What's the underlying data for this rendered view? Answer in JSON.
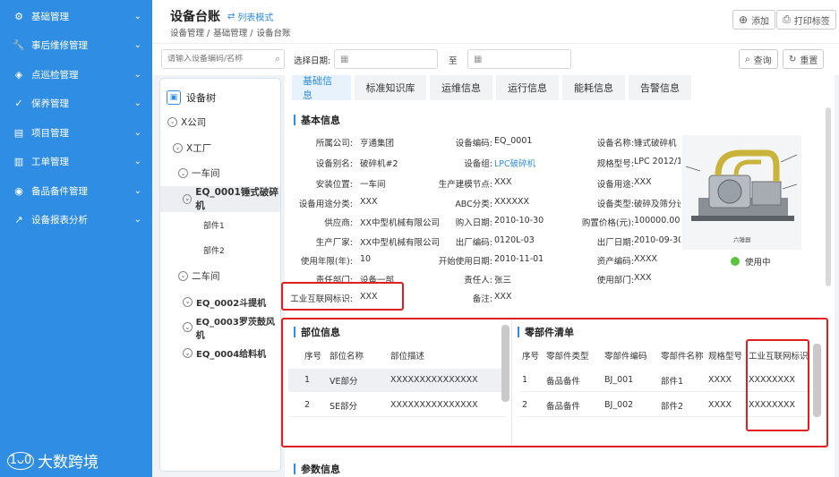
{
  "sidebar": {
    "items": [
      {
        "label": "基础管理",
        "icon": "gear-icon",
        "glyph": "⚙"
      },
      {
        "label": "事后维修管理",
        "icon": "wrench-icon",
        "glyph": "🔧"
      },
      {
        "label": "点巡检管理",
        "icon": "shield-icon",
        "glyph": "◈"
      },
      {
        "label": "保养管理",
        "icon": "check-circle-icon",
        "glyph": "✓"
      },
      {
        "label": "项目管理",
        "icon": "document-icon",
        "glyph": "▤"
      },
      {
        "label": "工单管理",
        "icon": "clipboard-icon",
        "glyph": "▥"
      },
      {
        "label": "备品备件管理",
        "icon": "box-icon",
        "glyph": "◉"
      },
      {
        "label": "设备报表分析",
        "icon": "chart-icon",
        "glyph": "↗"
      }
    ],
    "brand": "大数跨境"
  },
  "header": {
    "title": "设备台账",
    "mode_link": "列表模式",
    "breadcrumb": [
      "设备管理 /",
      "基础管理 /",
      "设备台账"
    ],
    "add_label": "添加",
    "print_label": "打印标签"
  },
  "filter": {
    "search_placeholder": "请输入设备编码/名称",
    "date_label": "选择日期:",
    "to_label": "至",
    "query_label": "查询",
    "reset_label": "重置"
  },
  "tree": {
    "title": "设备树",
    "nodes": [
      {
        "label": "X公司"
      },
      {
        "label": "X工厂"
      },
      {
        "label": "一车间"
      },
      {
        "label": "EQ_0001锤式破碎机"
      },
      {
        "label": "部件1"
      },
      {
        "label": "部件2"
      },
      {
        "label": "二车间"
      },
      {
        "label": "EQ_0002斗提机"
      },
      {
        "label": "EQ_0003罗茨鼓风机"
      },
      {
        "label": "EQ_0004给料机"
      }
    ]
  },
  "tabs": [
    "基础信息",
    "标准知识库",
    "运维信息",
    "运行信息",
    "能耗信息",
    "告警信息"
  ],
  "basic": {
    "section_title": "基本信息",
    "rows": [
      [
        {
          "l": "所属公司:",
          "v": "亨通集团"
        },
        {
          "l": "设备编码:",
          "v": "EQ_0001"
        },
        {
          "l": "设备名称:",
          "v": "锤式破碎机"
        }
      ],
      [
        {
          "l": "设备别名:",
          "v": "破碎机#2"
        },
        {
          "l": "设备组:",
          "v": "LPC破碎机"
        },
        {
          "l": "规格型号:",
          "v": "LPC 2012/11"
        }
      ],
      [
        {
          "l": "安装位置:",
          "v": "一车间"
        },
        {
          "l": "生产建模节点:",
          "v": "XXX"
        },
        {
          "l": "设备用途:",
          "v": "XXX"
        }
      ],
      [
        {
          "l": "设备用途分类:",
          "v": "XXX"
        },
        {
          "l": "ABC分类:",
          "v": "XXXXXX"
        },
        {
          "l": "设备类型:",
          "v": "破碎及筛分设备"
        }
      ],
      [
        {
          "l": "供应商:",
          "v": "XX中型机械有限公司"
        },
        {
          "l": "购入日期:",
          "v": "2010-10-30"
        },
        {
          "l": "购置价格(元):",
          "v": "100000.00"
        }
      ],
      [
        {
          "l": "生产厂家:",
          "v": "XX中型机械有限公司"
        },
        {
          "l": "出厂编码:",
          "v": "0120L-03"
        },
        {
          "l": "出厂日期:",
          "v": "2010-09-30"
        }
      ],
      [
        {
          "l": "使用年限(年):",
          "v": "10"
        },
        {
          "l": "开始使用日期:",
          "v": "2010-11-01"
        },
        {
          "l": "资产编码:",
          "v": "XXXX"
        }
      ],
      [
        {
          "l": "责任部门:",
          "v": "设备一部"
        },
        {
          "l": "责任人:",
          "v": "张三"
        },
        {
          "l": "使用部门:",
          "v": "XXX"
        }
      ],
      [
        {
          "l": "工业互联网标识:",
          "v": "XXX"
        },
        {
          "l": "备注:",
          "v": "XXX"
        }
      ]
    ],
    "photo_caption": "六锤器",
    "status": "使用中"
  },
  "parts": {
    "title": "部位信息",
    "headers": [
      "序号",
      "部位名称",
      "部位描述"
    ],
    "rows": [
      [
        "1",
        "VE部分",
        "XXXXXXXXXXXXXXX"
      ],
      [
        "2",
        "SE部分",
        "XXXXXXXXXXXXXXX"
      ]
    ]
  },
  "components": {
    "title": "零部件清单",
    "headers": [
      "序号",
      "零部件类型",
      "零部件编码",
      "零部件名称",
      "规格型号",
      "工业互联网标识"
    ],
    "rows": [
      [
        "1",
        "备品备件",
        "BJ_001",
        "部件1",
        "XXXX",
        "XXXXXXXX"
      ],
      [
        "2",
        "备品备件",
        "BJ_002",
        "部件2",
        "XXXX",
        "XXXXXXXX"
      ]
    ]
  },
  "params": {
    "title": "参数信息"
  },
  "colors": {
    "accent": "#2f8de3",
    "highlight": "#e02020",
    "status_green": "#5ac43c"
  }
}
